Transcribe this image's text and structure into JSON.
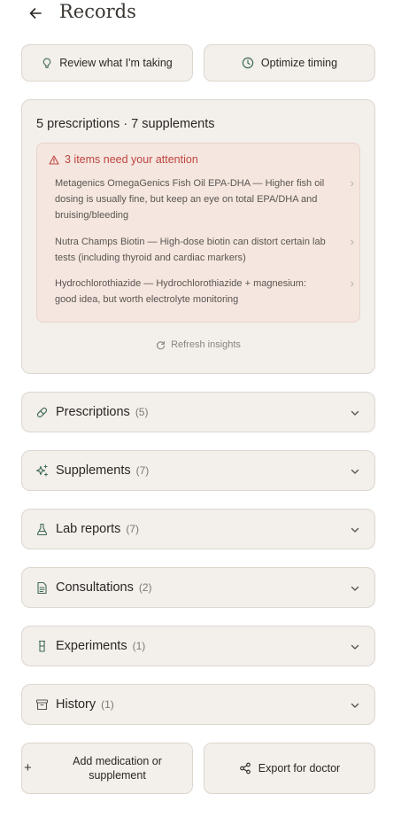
{
  "header": {
    "title": "Records"
  },
  "actions": {
    "review": "Review what I'm taking",
    "optimize": "Optimize timing"
  },
  "summary": {
    "title": "5 prescriptions · 7 supplements",
    "attention_title": "3 items need your attention",
    "items": [
      {
        "text": "Metagenics OmegaGenics Fish Oil EPA-DHA — Higher fish oil dosing is usually fine, but keep an eye on total EPA/DHA and bruising/bleeding"
      },
      {
        "text": "Nutra Champs Biotin — High-dose biotin can distort certain lab tests (including thyroid and cardiac markers)"
      },
      {
        "text": "Hydrochlorothiazide — Hydrochlorothiazide + magnesium: good idea, but worth electrolyte monitoring"
      }
    ],
    "refresh": "Refresh insights"
  },
  "sections": [
    {
      "label": "Prescriptions",
      "count": "(5)",
      "icon": "pill-icon"
    },
    {
      "label": "Supplements",
      "count": "(7)",
      "icon": "sparkle-icon"
    },
    {
      "label": "Lab reports",
      "count": "(7)",
      "icon": "flask-icon"
    },
    {
      "label": "Consultations",
      "count": "(2)",
      "icon": "document-icon"
    },
    {
      "label": "Experiments",
      "count": "(1)",
      "icon": "beaker-icon"
    },
    {
      "label": "History",
      "count": "(1)",
      "icon": "archive-icon"
    }
  ],
  "bottom": {
    "add": "Add medication or supplement",
    "export": "Export for doctor"
  },
  "colors": {
    "card_bg": "#f3efea",
    "border": "#dcd6ce",
    "alert": "#c0453f",
    "alert_bg": "#f5e6e0",
    "icon_green": "#3f6b57"
  }
}
